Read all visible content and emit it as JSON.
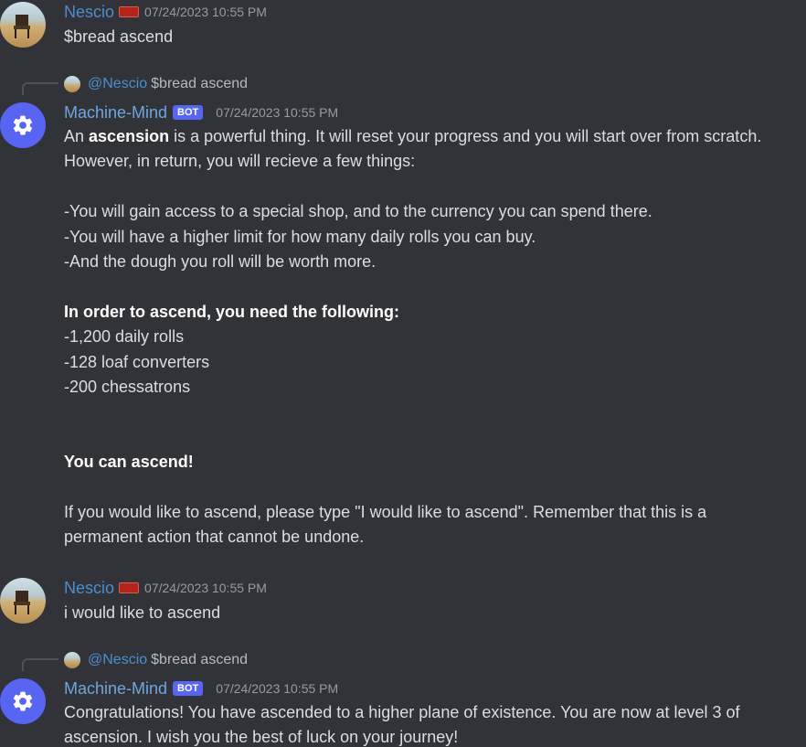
{
  "messages": [
    {
      "author": "Nescio",
      "timestamp": "07/24/2023 10:55 PM",
      "badge": "flag-badge",
      "lines": [
        "$bread ascend"
      ]
    },
    {
      "reply": {
        "mention": "@Nescio",
        "snippet": "$bread ascend"
      },
      "author": "Machine-Mind",
      "tag": "BOT",
      "timestamp": "07/24/2023 10:55 PM",
      "intro_pre": "An ",
      "intro_bold": "ascension",
      "intro_post": " is a powerful thing. It will reset your progress and you will start over from scratch.",
      "lines": [
        "However, in return, you will recieve a few things:",
        "",
        "-You will gain access to a special shop, and to the currency you can spend there.",
        "-You will have a higher limit for how many daily rolls you can buy.",
        "-And the dough you roll will be worth more.",
        "",
        "In order to ascend, you need the following:",
        "-1,200 daily rolls",
        "-128 loaf converters",
        "-200 chessatrons",
        "",
        "",
        "You can ascend!",
        "",
        "If you would like to ascend, please type \"I would like to ascend\". Remember that this is a",
        "permanent action that cannot be undone."
      ]
    },
    {
      "author": "Nescio",
      "timestamp": "07/24/2023 10:55 PM",
      "badge": "flag-badge",
      "lines": [
        "i would like to ascend"
      ]
    },
    {
      "reply": {
        "mention": "@Nescio",
        "snippet": "$bread ascend"
      },
      "author": "Machine-Mind",
      "tag": "BOT",
      "timestamp": "07/24/2023 10:55 PM",
      "lines": [
        "Congratulations! You have ascended to a higher plane of existence. You are now at level 3 of",
        "ascension. I wish you the best of luck on your journey!"
      ]
    }
  ],
  "colors": {
    "background": "#313338",
    "username_user": "#4a8fd1",
    "username_bot": "#6ea6e0",
    "bot_tag": "#5865f2",
    "timestamp": "#949ba4",
    "text": "#dbdee1"
  },
  "icons": {
    "user_avatar": "chair-in-desert-avatar",
    "bot_avatar": "gear-icon",
    "badge": "flag-badge-icon"
  }
}
